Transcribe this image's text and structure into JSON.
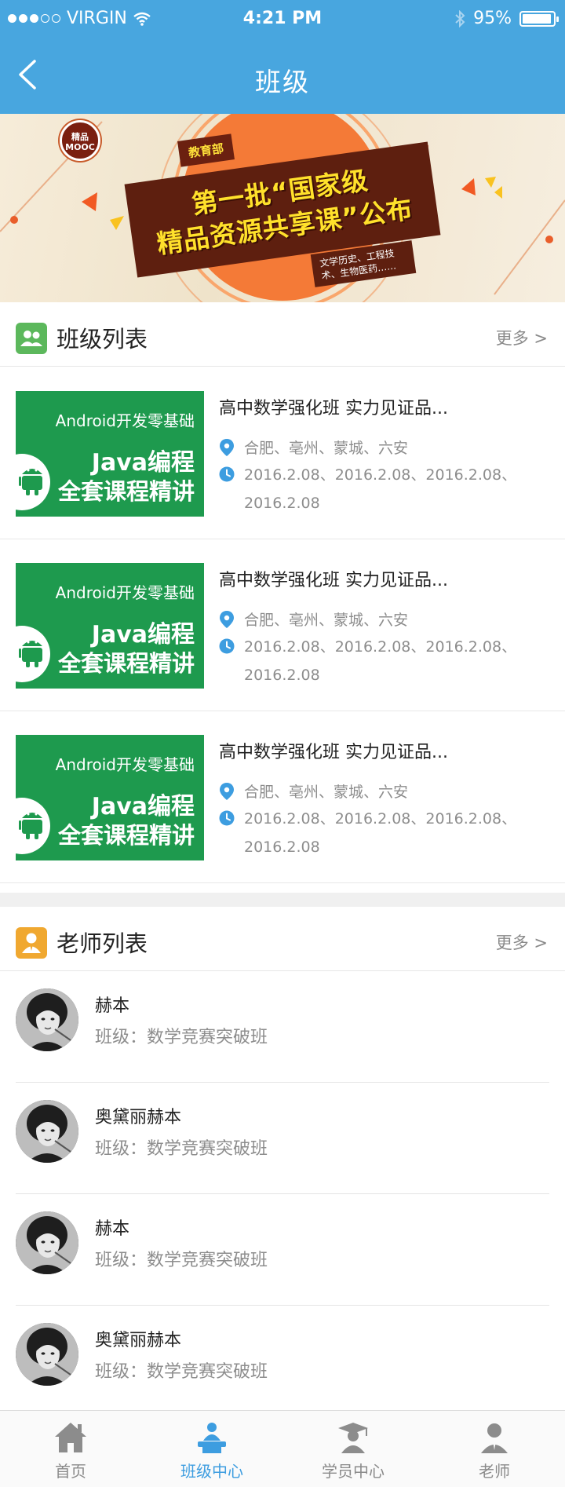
{
  "status_bar": {
    "carrier": "VIRGIN",
    "time": "4:21 PM",
    "battery": "95%"
  },
  "nav": {
    "title": "班级"
  },
  "banner": {
    "badge": "精品 MOOC",
    "tag": "教育部",
    "headline_line1": "第一批“国家级",
    "headline_line2": "精品资源共享课”公布",
    "sub": "文学历史、工程技术、生物医药……"
  },
  "class_section": {
    "title": "班级列表",
    "more": "更多 >",
    "items": [
      {
        "thumb_l1": "Android开发零基础",
        "thumb_l2": "Java编程",
        "thumb_l3": "全套课程精讲",
        "title": "高中数学强化班  实力见证品...",
        "location": "合肥、亳州、蒙城、六安",
        "dates": "2016.2.08、2016.2.08、2016.2.08、2016.2.08"
      },
      {
        "thumb_l1": "Android开发零基础",
        "thumb_l2": "Java编程",
        "thumb_l3": "全套课程精讲",
        "title": "高中数学强化班  实力见证品...",
        "location": "合肥、亳州、蒙城、六安",
        "dates": "2016.2.08、2016.2.08、2016.2.08、2016.2.08"
      },
      {
        "thumb_l1": "Android开发零基础",
        "thumb_l2": "Java编程",
        "thumb_l3": "全套课程精讲",
        "title": "高中数学强化班  实力见证品...",
        "location": "合肥、亳州、蒙城、六安",
        "dates": "2016.2.08、2016.2.08、2016.2.08、2016.2.08"
      }
    ]
  },
  "teacher_section": {
    "title": "老师列表",
    "more": "更多 >",
    "items": [
      {
        "name": "赫本",
        "class": "班级：数学竞赛突破班"
      },
      {
        "name": "奥黛丽赫本",
        "class": "班级：数学竞赛突破班"
      },
      {
        "name": "赫本",
        "class": "班级：数学竞赛突破班"
      },
      {
        "name": "奥黛丽赫本",
        "class": "班级：数学竞赛突破班"
      }
    ]
  },
  "tabbar": {
    "tabs": [
      {
        "label": "首页",
        "icon": "home-icon",
        "active": false
      },
      {
        "label": "班级中心",
        "icon": "class-center-icon",
        "active": true
      },
      {
        "label": "学员中心",
        "icon": "student-center-icon",
        "active": false
      },
      {
        "label": "老师",
        "icon": "teacher-icon",
        "active": false
      }
    ]
  },
  "colors": {
    "primary": "#48a6df",
    "tab_active": "#3d9de0",
    "thumb_green": "#1e9a4e",
    "class_icon_bg": "#5cb85c",
    "teacher_icon_bg": "#f0a830"
  }
}
